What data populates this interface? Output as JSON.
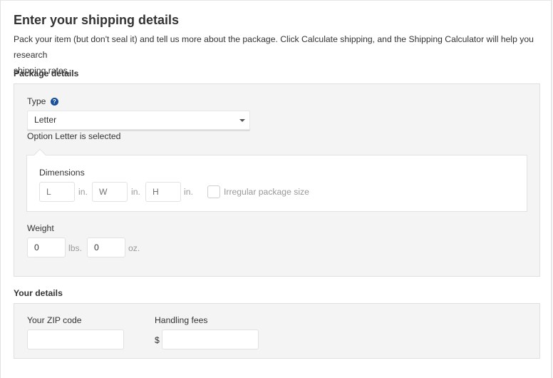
{
  "header": {
    "title": "Enter your shipping details",
    "intro_line1": "Pack your item (but don't seal it) and tell us more about the package. Click Calculate shipping, and the Shipping Calculator will help you research",
    "intro_line2": "shipping rates."
  },
  "package_details": {
    "heading": "Package details",
    "type_label": "Type",
    "help_icon": "question-circle-icon",
    "type_select": {
      "selected": "Letter",
      "status_text": "Option Letter is selected"
    },
    "dimensions": {
      "label": "Dimensions",
      "length_placeholder": "L",
      "width_placeholder": "W",
      "height_placeholder": "H",
      "unit": "in.",
      "irregular_label": "Irregular package size",
      "irregular_checked": false
    },
    "weight": {
      "label": "Weight",
      "lbs_value": "0",
      "lbs_unit": "lbs.",
      "oz_value": "0",
      "oz_unit": "oz."
    }
  },
  "your_details": {
    "heading": "Your details",
    "zip_label": "Your ZIP code",
    "zip_value": "",
    "handling_label": "Handling fees",
    "currency_symbol": "$",
    "handling_value": ""
  },
  "colors": {
    "panel_bg": "#f4f4f4",
    "help_icon": "#1a4f9c",
    "text": "#333333",
    "muted": "#999999"
  }
}
